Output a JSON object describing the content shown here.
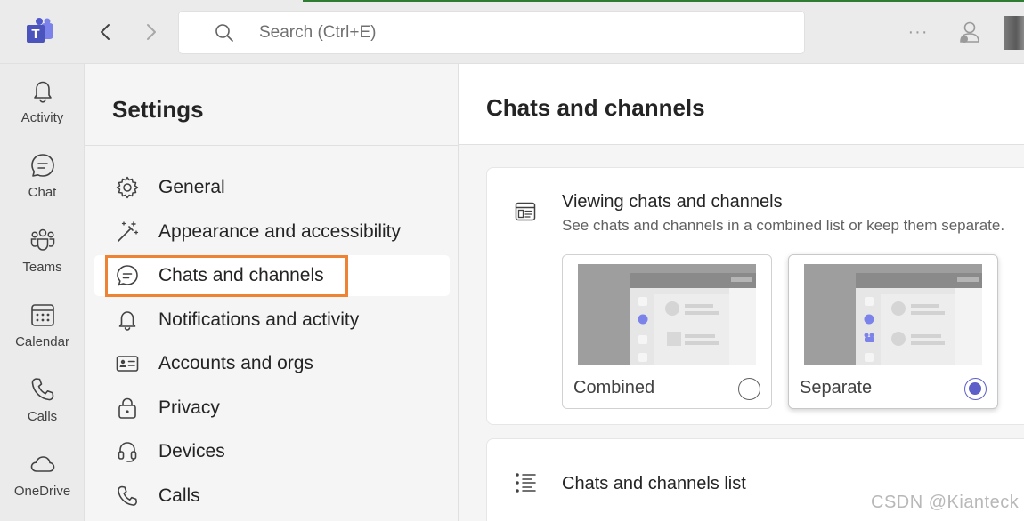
{
  "topbar": {
    "search_placeholder": "Search (Ctrl+E)",
    "more_label": "···"
  },
  "rail": {
    "items": [
      {
        "label": "Activity",
        "icon": "bell-icon"
      },
      {
        "label": "Chat",
        "icon": "chat-icon"
      },
      {
        "label": "Teams",
        "icon": "teams-icon"
      },
      {
        "label": "Calendar",
        "icon": "calendar-icon"
      },
      {
        "label": "Calls",
        "icon": "phone-icon"
      },
      {
        "label": "OneDrive",
        "icon": "cloud-icon"
      }
    ]
  },
  "settings": {
    "title": "Settings",
    "items": [
      {
        "label": "General",
        "icon": "gear-icon"
      },
      {
        "label": "Appearance and accessibility",
        "icon": "magic-wand-icon"
      },
      {
        "label": "Chats and channels",
        "icon": "chat-icon",
        "active": true
      },
      {
        "label": "Notifications and activity",
        "icon": "bell-icon"
      },
      {
        "label": "Accounts and orgs",
        "icon": "id-card-icon"
      },
      {
        "label": "Privacy",
        "icon": "lock-icon"
      },
      {
        "label": "Devices",
        "icon": "headset-icon"
      },
      {
        "label": "Calls",
        "icon": "phone-icon"
      }
    ]
  },
  "main": {
    "title": "Chats and channels",
    "viewing": {
      "title": "Viewing chats and channels",
      "subtitle": "See chats and channels in a combined list or keep them separate.",
      "options": [
        {
          "label": "Combined",
          "selected": false
        },
        {
          "label": "Separate",
          "selected": true
        }
      ]
    },
    "list_section": {
      "title": "Chats and channels list"
    }
  },
  "watermark": "CSDN @Kianteck",
  "colors": {
    "accent": "#5b5fc7",
    "highlight_border": "#ee8433"
  }
}
